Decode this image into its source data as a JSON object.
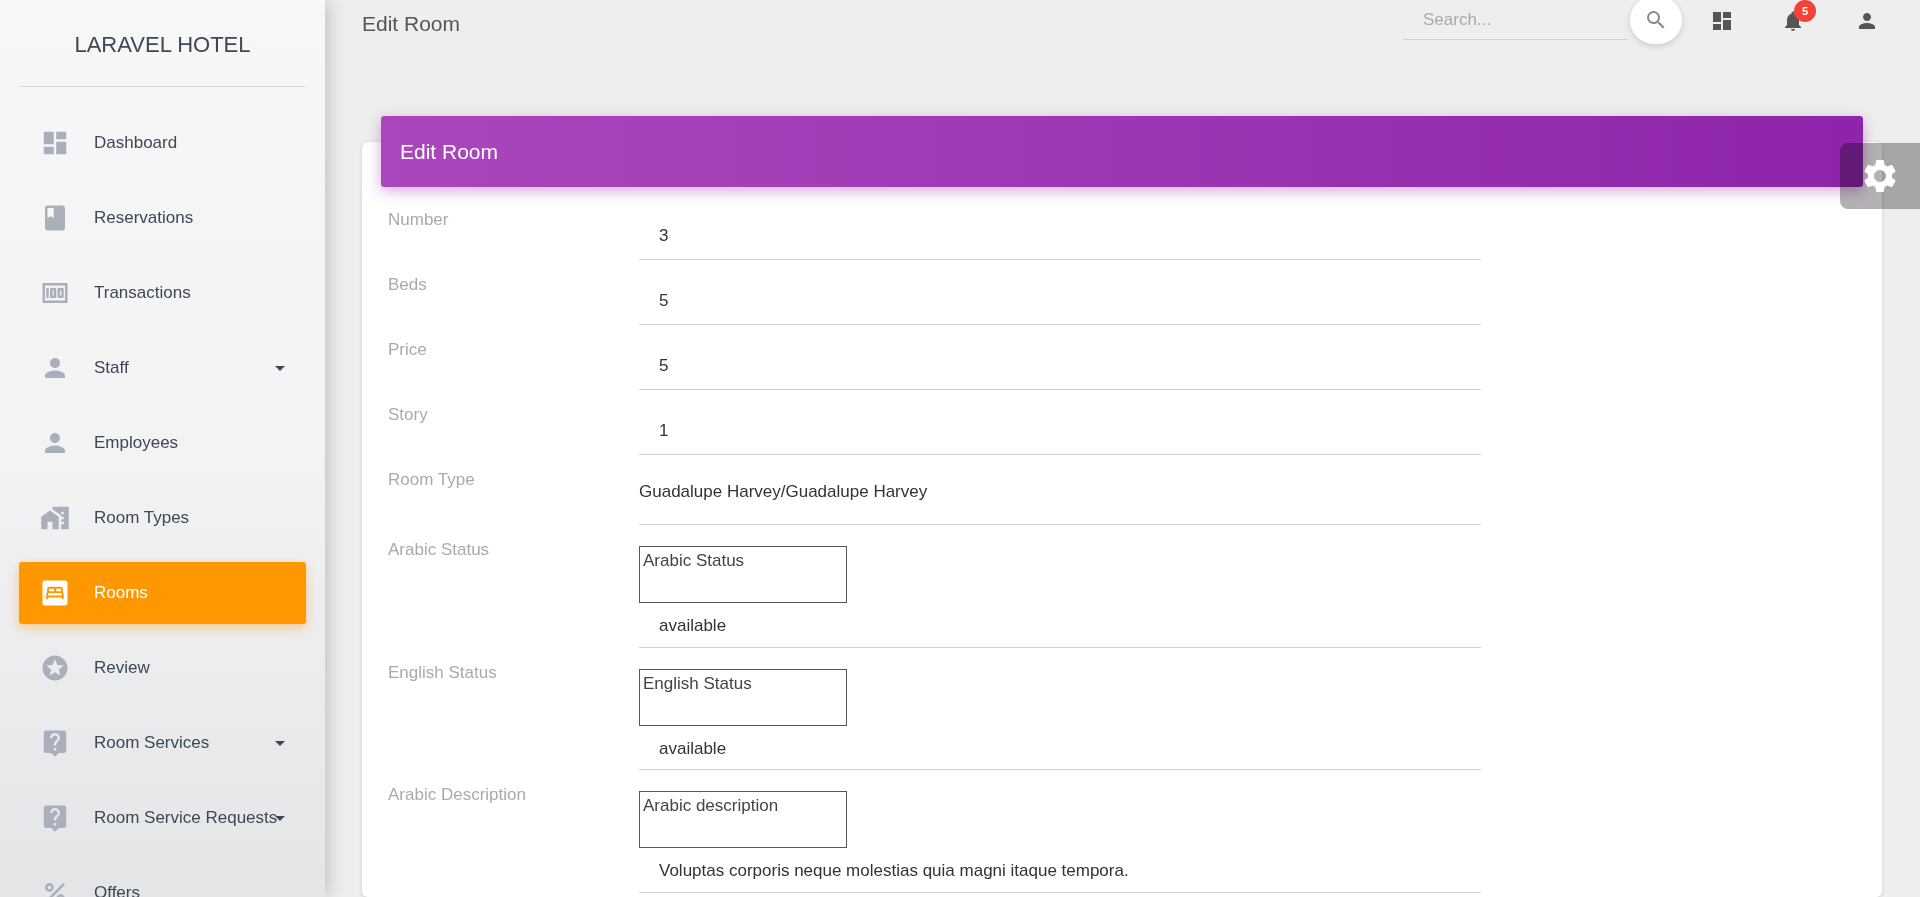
{
  "sidebar": {
    "brand": "LARAVEL HOTEL",
    "items": [
      {
        "label": "Dashboard",
        "selected": false,
        "expandable": false
      },
      {
        "label": "Reservations",
        "selected": false,
        "expandable": false
      },
      {
        "label": "Transactions",
        "selected": false,
        "expandable": false
      },
      {
        "label": "Staff",
        "selected": false,
        "expandable": true
      },
      {
        "label": "Employees",
        "selected": false,
        "expandable": false
      },
      {
        "label": "Room Types",
        "selected": false,
        "expandable": false
      },
      {
        "label": "Rooms",
        "selected": true,
        "expandable": false
      },
      {
        "label": "Review",
        "selected": false,
        "expandable": false
      },
      {
        "label": "Room Services",
        "selected": false,
        "expandable": true
      },
      {
        "label": "Room Service Requests",
        "selected": false,
        "expandable": true
      },
      {
        "label": "Offers",
        "selected": false,
        "expandable": false
      }
    ]
  },
  "topbar": {
    "title": "Edit Room",
    "search": {
      "placeholder": "Search..."
    },
    "notifications": "5"
  },
  "card": {
    "title": "Edit Room",
    "fields": [
      {
        "kind": "text",
        "label": "Number",
        "value": "3"
      },
      {
        "kind": "text",
        "label": "Beds",
        "value": "5"
      },
      {
        "kind": "text",
        "label": "Price",
        "value": "5"
      },
      {
        "kind": "text",
        "label": "Story",
        "value": "1"
      },
      {
        "kind": "select",
        "label": "Room Type",
        "value": "Guadalupe Harvey/Guadalupe Harvey"
      },
      {
        "kind": "textarea",
        "label": "Arabic Status",
        "placeholder": "Arabic Status",
        "value": "available"
      },
      {
        "kind": "textarea",
        "label": "English Status",
        "placeholder": "English Status",
        "value": "available"
      },
      {
        "kind": "textarea",
        "label": "Arabic Description",
        "placeholder": "Arabic description",
        "value": "Voluptas corporis neque molestias quia magni itaque tempora."
      }
    ]
  }
}
